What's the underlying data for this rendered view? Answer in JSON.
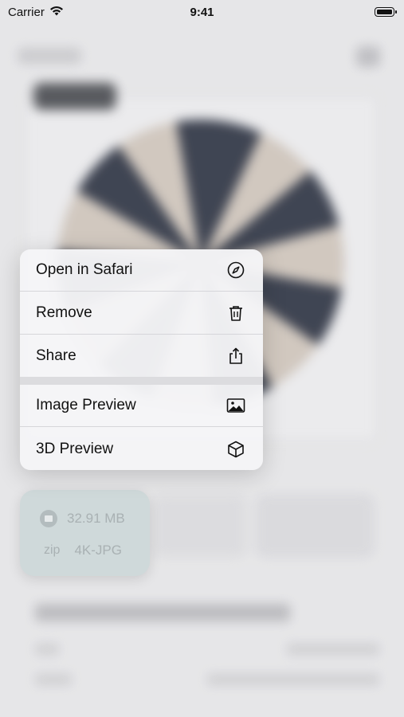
{
  "status_bar": {
    "carrier": "Carrier",
    "time": "9:41"
  },
  "context_menu": {
    "items": [
      {
        "label": "Open in Safari",
        "icon": "compass-icon"
      },
      {
        "label": "Remove",
        "icon": "trash-icon"
      },
      {
        "label": "Share",
        "icon": "share-icon"
      },
      {
        "label": "Image Preview",
        "icon": "photo-icon"
      },
      {
        "label": "3D Preview",
        "icon": "cube-icon"
      }
    ]
  },
  "preview_chip": {
    "size": "32.91 MB",
    "format": "zip",
    "resolution": "4K-JPG"
  },
  "colors": {
    "menu_bg": "#f5f5f7",
    "chip_bg": "#cfd9da",
    "text": "#111111"
  }
}
